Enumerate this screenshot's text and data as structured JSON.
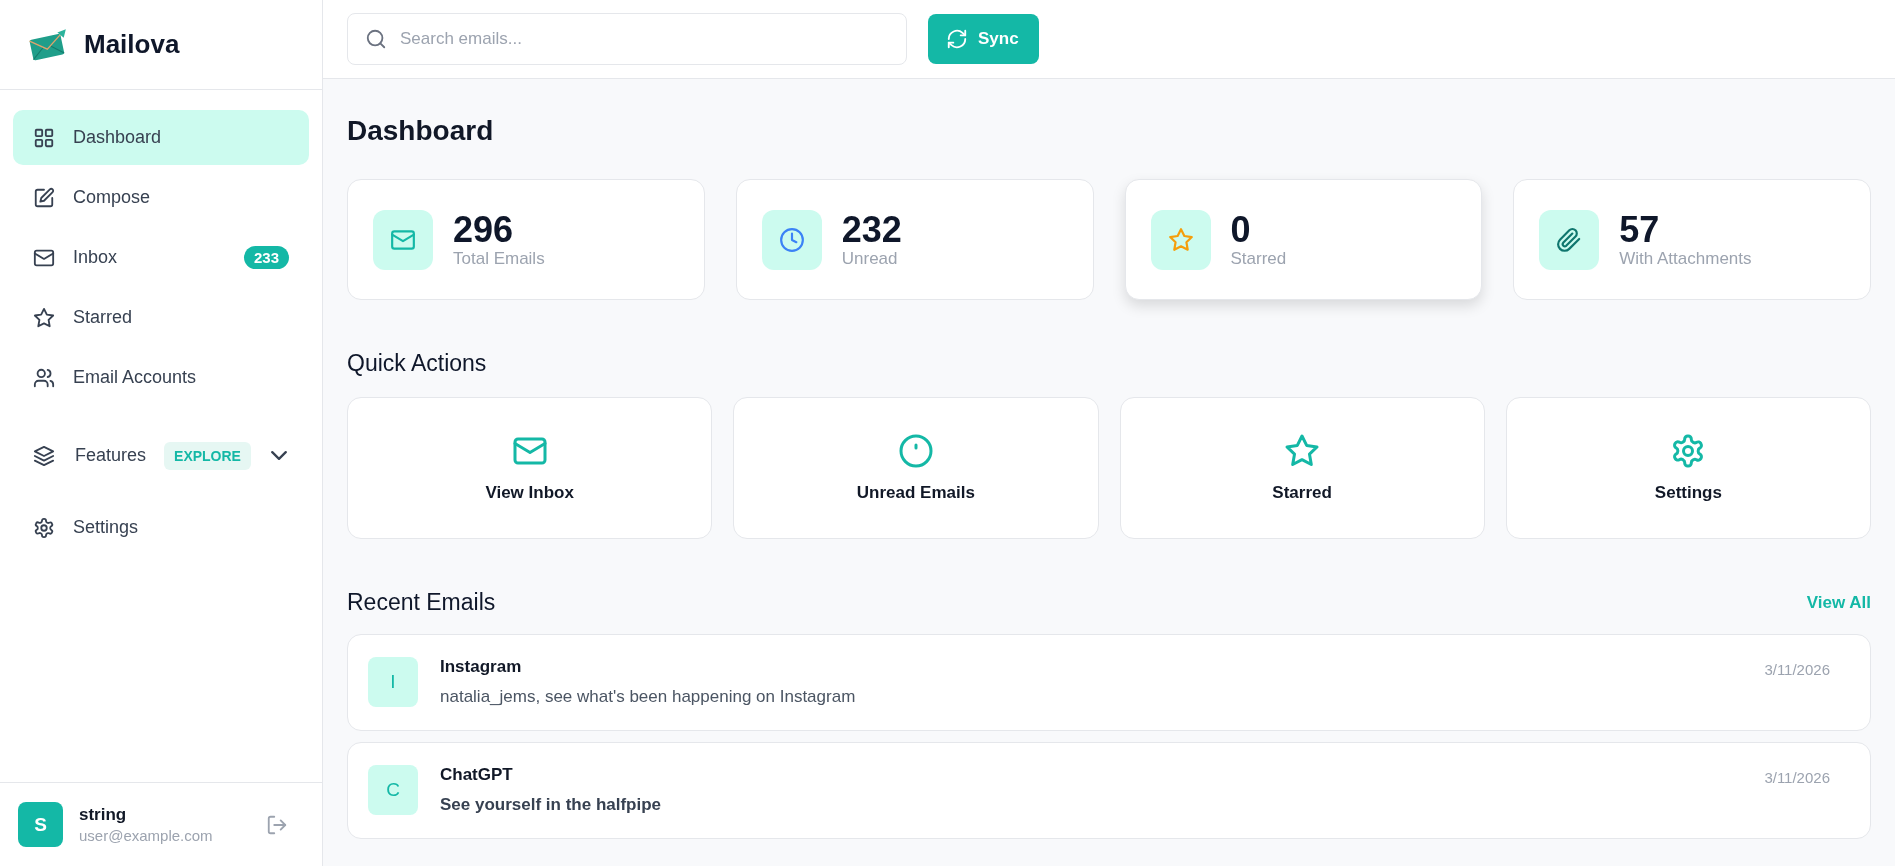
{
  "app": {
    "name": "Mailova"
  },
  "sidebar": {
    "items": [
      {
        "label": "Dashboard",
        "selected": true
      },
      {
        "label": "Compose",
        "selected": false
      },
      {
        "label": "Inbox",
        "selected": false,
        "badge": "233"
      },
      {
        "label": "Starred",
        "selected": false
      },
      {
        "label": "Email Accounts",
        "selected": false
      },
      {
        "label": "Features",
        "selected": false,
        "tag": "EXPLORE",
        "expanded": false
      },
      {
        "label": "Settings",
        "selected": false
      }
    ],
    "user": {
      "initial": "S",
      "name": "string",
      "email": "user@example.com"
    }
  },
  "topbar": {
    "search": {
      "placeholder": "Search emails..."
    },
    "sync_button": "Sync"
  },
  "page_title": "Dashboard",
  "stats": [
    {
      "value": "296",
      "label": "Total Emails",
      "hovered": false
    },
    {
      "value": "232",
      "label": "Unread",
      "hovered": false
    },
    {
      "value": "0",
      "label": "Starred",
      "hovered": true
    },
    {
      "value": "57",
      "label": "With Attachments",
      "hovered": false
    }
  ],
  "quick_actions": {
    "title": "Quick Actions",
    "items": [
      "View Inbox",
      "Unread Emails",
      "Starred",
      "Settings"
    ]
  },
  "recent_emails": {
    "title": "Recent Emails",
    "view_all": "View All",
    "items": [
      {
        "initial": "I",
        "sender": "Instagram",
        "subject": "natalia_jems, see what's been happening on Instagram",
        "date": "3/11/2026",
        "unread": false
      },
      {
        "initial": "C",
        "sender": "ChatGPT",
        "subject": "See yourself in the halfpipe",
        "date": "3/11/2026",
        "unread": true
      }
    ]
  }
}
